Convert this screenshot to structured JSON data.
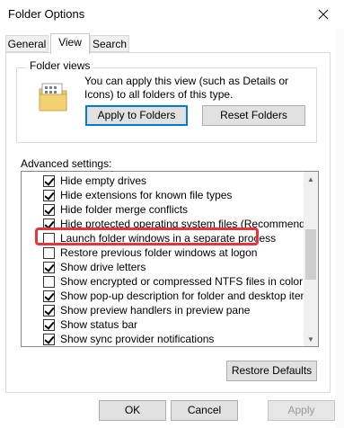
{
  "window": {
    "title": "Folder Options"
  },
  "tabs": [
    {
      "label": "General"
    },
    {
      "label": "View"
    },
    {
      "label": "Search"
    }
  ],
  "folder_views": {
    "group_label": "Folder views",
    "description": "You can apply this view (such as Details or Icons) to all folders of this type.",
    "apply_button": "Apply to Folders",
    "reset_button": "Reset Folders"
  },
  "advanced": {
    "label": "Advanced settings:",
    "items": [
      {
        "label": "Hide empty drives",
        "checked": true
      },
      {
        "label": "Hide extensions for known file types",
        "checked": true
      },
      {
        "label": "Hide folder merge conflicts",
        "checked": true
      },
      {
        "label": "Hide protected operating system files (Recommended)",
        "checked": true
      },
      {
        "label": "Launch folder windows in a separate process",
        "checked": false
      },
      {
        "label": "Restore previous folder windows at logon",
        "checked": false
      },
      {
        "label": "Show drive letters",
        "checked": true
      },
      {
        "label": "Show encrypted or compressed NTFS files in color",
        "checked": false
      },
      {
        "label": "Show pop-up description for folder and desktop items",
        "checked": true
      },
      {
        "label": "Show preview handlers in preview pane",
        "checked": true
      },
      {
        "label": "Show status bar",
        "checked": true
      },
      {
        "label": "Show sync provider notifications",
        "checked": true
      }
    ]
  },
  "restore_defaults_label": "Restore Defaults",
  "footer": {
    "ok": "OK",
    "cancel": "Cancel",
    "apply": "Apply"
  },
  "colors": {
    "highlight": "#e5343a",
    "focus_border": "#0078d7"
  }
}
